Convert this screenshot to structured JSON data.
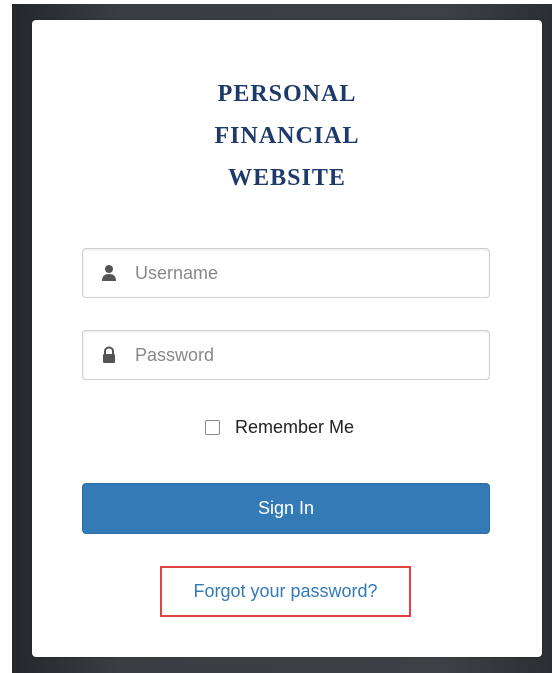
{
  "login": {
    "title_lines": [
      "Personal",
      "Financial",
      "Website"
    ],
    "username": {
      "placeholder": "Username",
      "value": "",
      "icon": "user-icon"
    },
    "password": {
      "placeholder": "Password",
      "value": "",
      "icon": "lock-icon"
    },
    "remember_me_label": "Remember Me",
    "remember_me_checked": false,
    "sign_in_label": "Sign In",
    "forgot_password_label": "Forgot your password?"
  },
  "colors": {
    "title": "#1d3a6a",
    "primary_button": "#337ab7",
    "link": "#337ab7",
    "highlight_border": "#e0443e",
    "background_dark": "#3a3e43"
  }
}
